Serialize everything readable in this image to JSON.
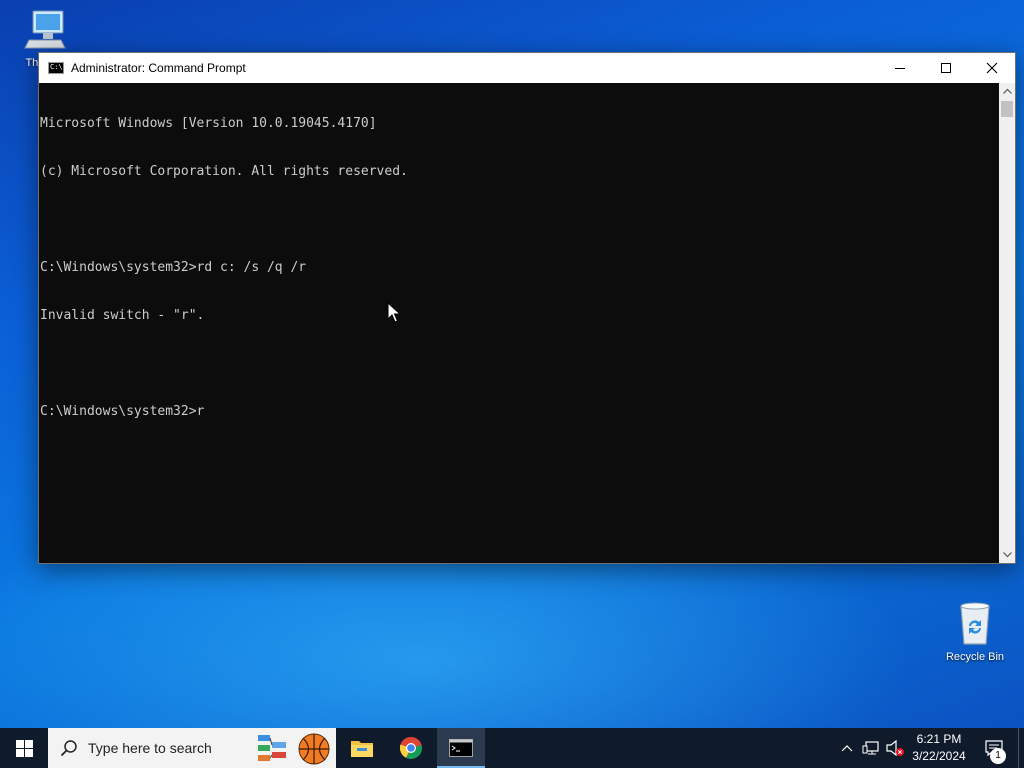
{
  "desktop": {
    "icons": [
      {
        "label": "This PC",
        "icon": "computer-icon"
      },
      {
        "label": "Recycle Bin",
        "icon": "recycle-bin-icon"
      }
    ]
  },
  "window": {
    "title": "Administrator: Command Prompt",
    "icon": "cmd-icon",
    "console_lines": [
      "Microsoft Windows [Version 10.0.19045.4170]",
      "(c) Microsoft Corporation. All rights reserved.",
      "",
      "C:\\Windows\\system32>rd c: /s /q /r",
      "Invalid switch - \"r\".",
      "",
      "C:\\Windows\\system32>r"
    ],
    "controls": [
      "minimize",
      "maximize",
      "close"
    ],
    "colors": {
      "console_bg": "#0c0c0c",
      "console_text": "#cccccc",
      "title_bg": "#ffffff"
    }
  },
  "taskbar": {
    "search_placeholder": "Type here to search",
    "pinned": [
      "file-explorer-icon",
      "chrome-icon",
      "command-prompt-icon"
    ],
    "clock": {
      "time": "6:21 PM",
      "date": "3/22/2024"
    },
    "notification_count": "1",
    "colors": {
      "bg": "#0f1a2b",
      "active_accent": "#76b9ed"
    }
  }
}
